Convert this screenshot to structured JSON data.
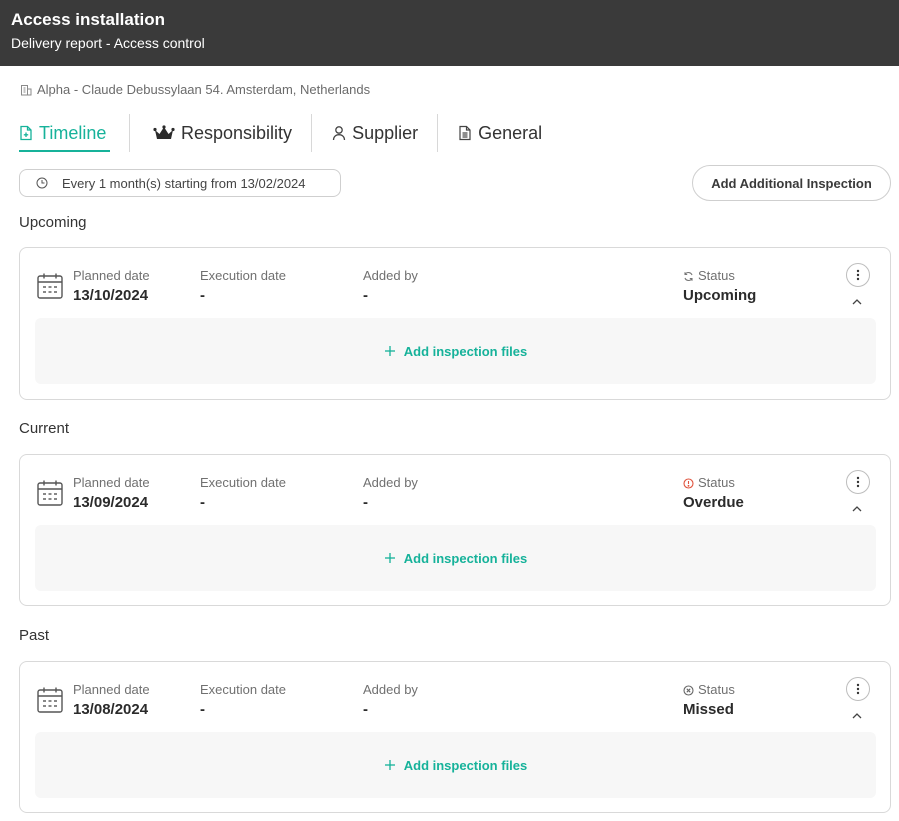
{
  "header": {
    "title": "Access installation",
    "subtitle": "Delivery report - Access control"
  },
  "location": {
    "icon": "building-icon",
    "text": "Alpha - Claude Debussylaan 54. Amsterdam, Netherlands"
  },
  "tabs": [
    {
      "label": "Timeline",
      "icon": "document-plus-icon",
      "active": true
    },
    {
      "label": "Responsibility",
      "icon": "crown-icon",
      "active": false
    },
    {
      "label": "Supplier",
      "icon": "person-icon",
      "active": false
    },
    {
      "label": "General",
      "icon": "document-icon",
      "active": false
    }
  ],
  "recurrence": {
    "icon": "clock-icon",
    "text": "Every 1 month(s) starting from 13/02/2024"
  },
  "add_inspection_label": "Add Additional Inspection",
  "sections": [
    {
      "label": "Upcoming",
      "card": {
        "planned_label": "Planned date",
        "planned_value": "13/10/2024",
        "execution_label": "Execution date",
        "execution_value": "-",
        "added_label": "Added by",
        "added_value": "-",
        "status_label": "Status",
        "status_value": "Upcoming",
        "status_icon": "refresh-icon",
        "files_label": "Add inspection files"
      }
    },
    {
      "label": "Current",
      "card": {
        "planned_label": "Planned date",
        "planned_value": "13/09/2024",
        "execution_label": "Execution date",
        "execution_value": "-",
        "added_label": "Added by",
        "added_value": "-",
        "status_label": "Status",
        "status_value": "Overdue",
        "status_icon": "alert-circle-icon",
        "files_label": "Add inspection files"
      }
    },
    {
      "label": "Past",
      "card": {
        "planned_label": "Planned date",
        "planned_value": "13/08/2024",
        "execution_label": "Execution date",
        "execution_value": "-",
        "added_label": "Added by",
        "added_value": "-",
        "status_label": "Status",
        "status_value": "Missed",
        "status_icon": "x-circle-icon",
        "files_label": "Add inspection files"
      }
    }
  ],
  "colors": {
    "accent": "#16b29a",
    "header_bg": "#3a3a3a",
    "overdue": "#e0533d"
  }
}
